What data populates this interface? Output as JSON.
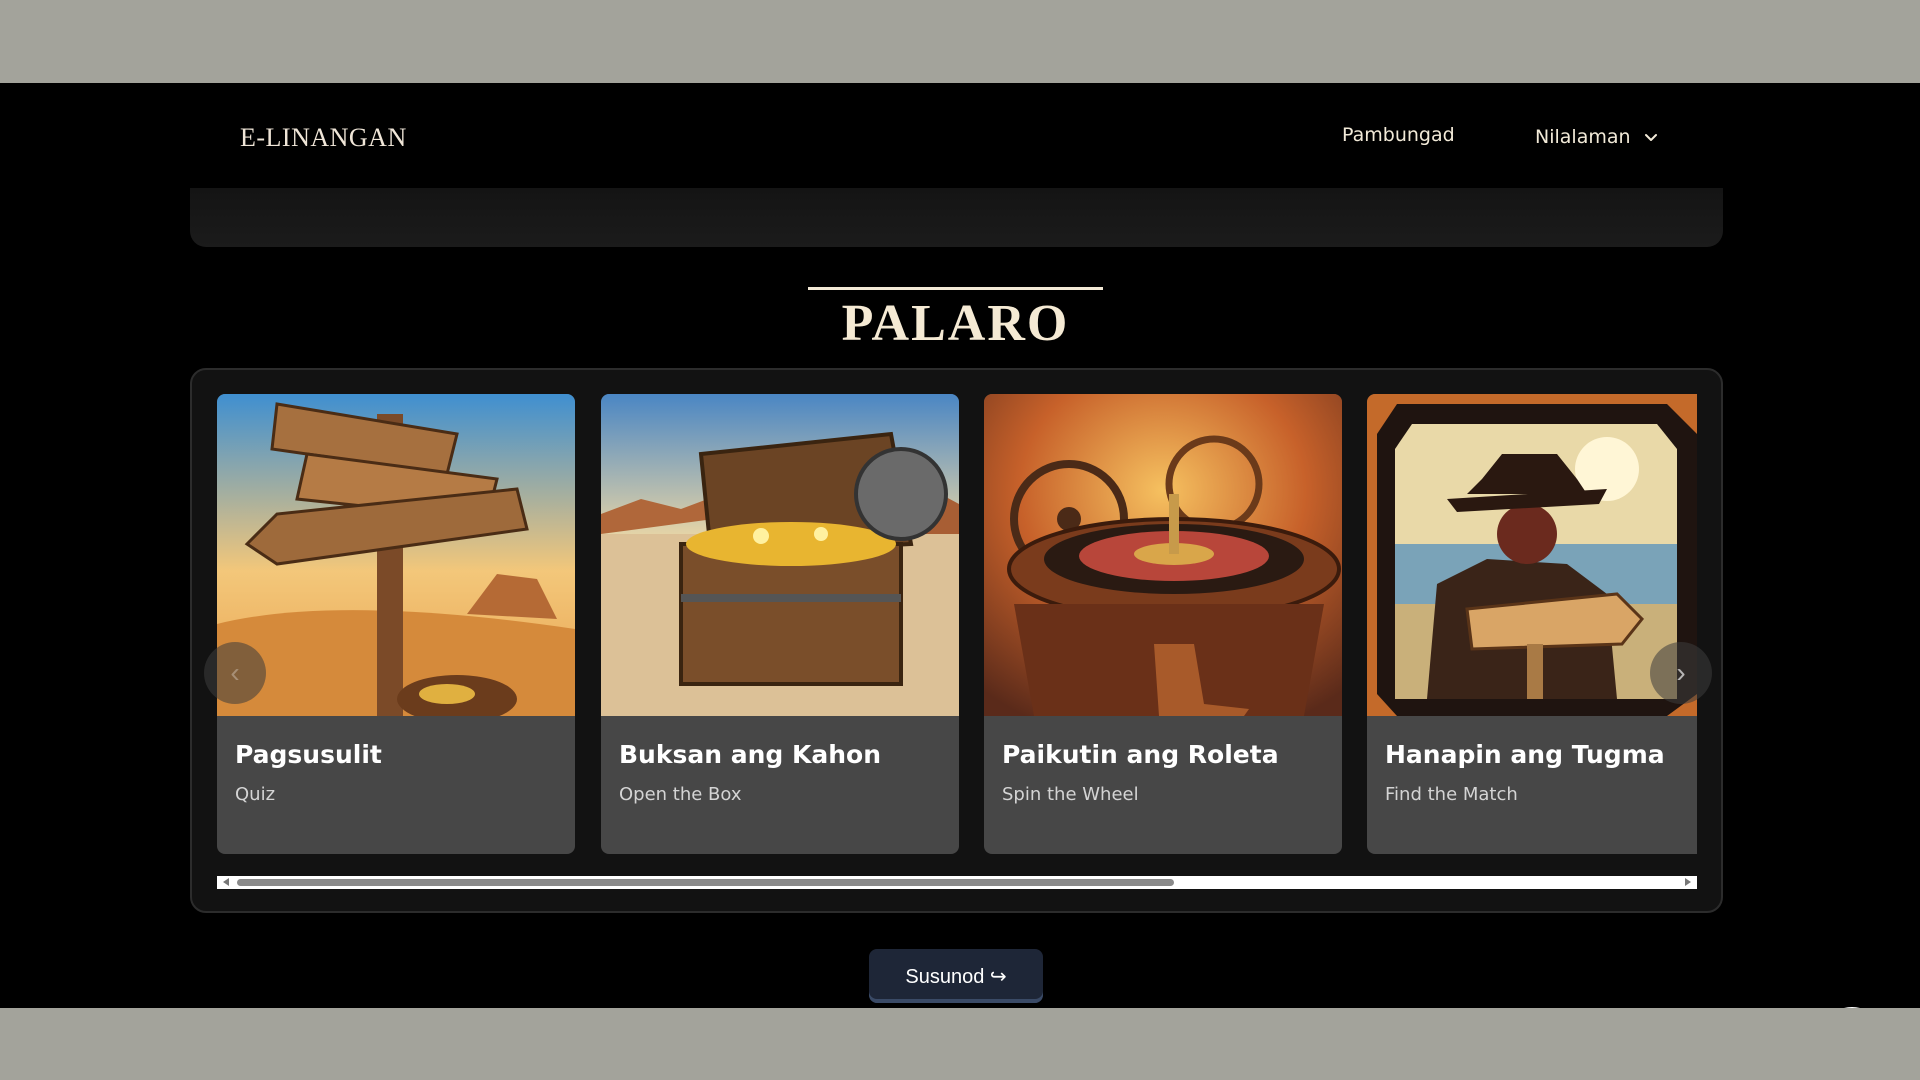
{
  "header": {
    "brand": "E-LINANGAN",
    "nav_home": "Pambungad",
    "nav_contents": "Nilalaman"
  },
  "section": {
    "title": "PALARO"
  },
  "games": [
    {
      "title": "Pagsusulit",
      "subtitle": "Quiz",
      "image": "signpost-illustration"
    },
    {
      "title": "Buksan ang Kahon",
      "subtitle": "Open the Box",
      "image": "treasure-chest-illustration"
    },
    {
      "title": "Paikutin ang Roleta",
      "subtitle": "Spin the Wheel",
      "image": "roulette-wheel-illustration"
    },
    {
      "title": "Hanapin ang Tugma",
      "subtitle": "Find the Match",
      "image": "cowboy-sign-illustration"
    }
  ],
  "carousel": {
    "prev_icon": "chevron-left-icon",
    "next_icon": "chevron-right-icon",
    "prev_glyph": "‹",
    "next_glyph": "›",
    "scroll_position": 0.0
  },
  "actions": {
    "next_label": "Susunod ↪",
    "back_to_top_icon": "arrow-up-icon"
  },
  "colors": {
    "page_bg": "#000000",
    "card_bg": "#474747",
    "title_cream": "#f5ead4",
    "button_navy": "#1e2637"
  }
}
